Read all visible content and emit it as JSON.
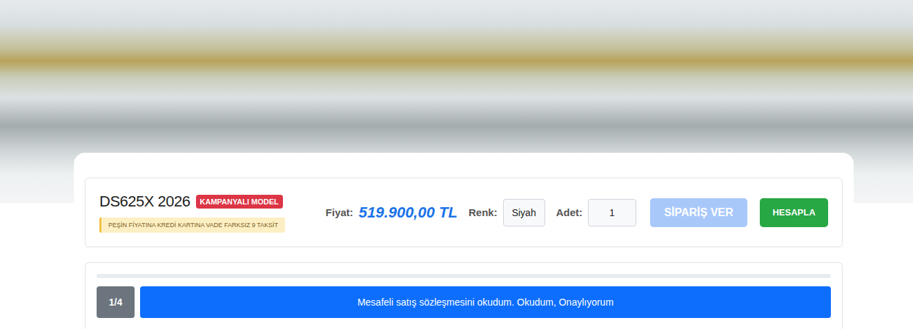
{
  "product": {
    "title": "DS625X 2026",
    "badge": "KAMPANYALI MODEL",
    "note": "PEŞİN FİYATINA KREDİ KARTINA VADE FARKSIZ 9 TAKSİT",
    "price_label": "Fiyat:",
    "price": "519.900,00 TL",
    "color_label": "Renk:",
    "color_value": "Siyah",
    "qty_label": "Adet:",
    "qty_value": "1"
  },
  "buttons": [
    {
      "label": "SİPARİŞ VER",
      "kind": "order",
      "disabled": true
    },
    {
      "label": "HESAPLA",
      "kind": "calc",
      "disabled": false
    }
  ],
  "progress": {
    "level": 0
  },
  "step": {
    "counter": "1/4",
    "label": "Mesafeli satış sözleşmesini okudum. Okudum, Onaylıyorum",
    "selected": true
  }
}
